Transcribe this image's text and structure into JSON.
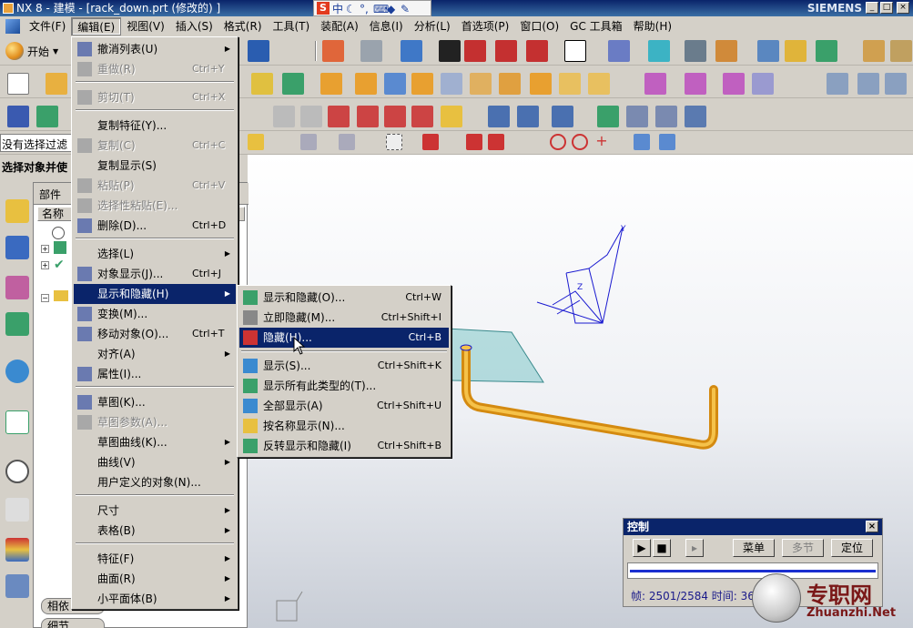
{
  "window": {
    "title": "NX 8 - 建模 - [rack_down.prt (修改的) ]",
    "brand": "SIEMENS"
  },
  "ime": {
    "logo": "S",
    "mode": "中"
  },
  "menubar": {
    "items": [
      "文件(F)",
      "编辑(E)",
      "视图(V)",
      "插入(S)",
      "格式(R)",
      "工具(T)",
      "装配(A)",
      "信息(I)",
      "分析(L)",
      "首选项(P)",
      "窗口(O)",
      "GC 工具箱",
      "帮助(H)"
    ]
  },
  "toolbar": {
    "start_label": "开始"
  },
  "filter": {
    "label": "没有选择过滤"
  },
  "select_row": {
    "label": "选择对象并使"
  },
  "navigator": {
    "title": "部件",
    "col_name": "名称",
    "buttons": [
      "相依",
      "细节"
    ]
  },
  "edit_menu": {
    "items": [
      {
        "label": "撤消列表(U)",
        "shortcut": "",
        "submenu": true,
        "disabled": false,
        "icon": "undo-list-icon"
      },
      {
        "label": "重做(R)",
        "shortcut": "Ctrl+Y",
        "submenu": false,
        "disabled": true,
        "icon": "redo-icon"
      },
      {
        "label": "剪切(T)",
        "shortcut": "Ctrl+X",
        "submenu": false,
        "disabled": true,
        "icon": "cut-icon"
      },
      {
        "label": "复制特征(Y)...",
        "shortcut": "",
        "submenu": false,
        "disabled": false,
        "icon": ""
      },
      {
        "label": "复制(C)",
        "shortcut": "Ctrl+C",
        "submenu": false,
        "disabled": true,
        "icon": "copy-icon"
      },
      {
        "label": "复制显示(S)",
        "shortcut": "",
        "submenu": false,
        "disabled": false,
        "icon": ""
      },
      {
        "label": "粘贴(P)",
        "shortcut": "Ctrl+V",
        "submenu": false,
        "disabled": true,
        "icon": "paste-icon"
      },
      {
        "label": "选择性粘贴(E)...",
        "shortcut": "",
        "submenu": false,
        "disabled": true,
        "icon": "paste-special-icon"
      },
      {
        "label": "删除(D)...",
        "shortcut": "Ctrl+D",
        "submenu": false,
        "disabled": false,
        "icon": "delete-icon"
      },
      {
        "label": "选择(L)",
        "shortcut": "",
        "submenu": true,
        "disabled": false,
        "icon": ""
      },
      {
        "label": "对象显示(J)...",
        "shortcut": "Ctrl+J",
        "submenu": false,
        "disabled": false,
        "icon": "object-display-icon"
      },
      {
        "label": "显示和隐藏(H)",
        "shortcut": "",
        "submenu": true,
        "disabled": false,
        "icon": "",
        "highlighted": true
      },
      {
        "label": "变换(M)...",
        "shortcut": "",
        "submenu": false,
        "disabled": false,
        "icon": "transform-icon"
      },
      {
        "label": "移动对象(O)...",
        "shortcut": "Ctrl+T",
        "submenu": false,
        "disabled": false,
        "icon": "move-object-icon"
      },
      {
        "label": "对齐(A)",
        "shortcut": "",
        "submenu": true,
        "disabled": false,
        "icon": ""
      },
      {
        "label": "属性(I)...",
        "shortcut": "",
        "submenu": false,
        "disabled": false,
        "icon": "properties-icon"
      },
      {
        "label": "草图(K)...",
        "shortcut": "",
        "submenu": false,
        "disabled": false,
        "icon": "sketch-icon"
      },
      {
        "label": "草图参数(A)...",
        "shortcut": "",
        "submenu": false,
        "disabled": true,
        "icon": "sketch-params-icon"
      },
      {
        "label": "草图曲线(K)...",
        "shortcut": "",
        "submenu": true,
        "disabled": false,
        "icon": ""
      },
      {
        "label": "曲线(V)",
        "shortcut": "",
        "submenu": true,
        "disabled": false,
        "icon": ""
      },
      {
        "label": "用户定义的对象(N)...",
        "shortcut": "",
        "submenu": false,
        "disabled": false,
        "icon": ""
      },
      {
        "label": "尺寸",
        "shortcut": "",
        "submenu": true,
        "disabled": false,
        "icon": ""
      },
      {
        "label": "表格(B)",
        "shortcut": "",
        "submenu": true,
        "disabled": false,
        "icon": ""
      },
      {
        "label": "特征(F)",
        "shortcut": "",
        "submenu": true,
        "disabled": false,
        "icon": ""
      },
      {
        "label": "曲面(R)",
        "shortcut": "",
        "submenu": true,
        "disabled": false,
        "icon": ""
      },
      {
        "label": "小平面体(B)",
        "shortcut": "",
        "submenu": true,
        "disabled": false,
        "icon": ""
      }
    ]
  },
  "show_hide_menu": {
    "items": [
      {
        "label": "显示和隐藏(O)...",
        "shortcut": "Ctrl+W",
        "icon": "show-hide-icon"
      },
      {
        "label": "立即隐藏(M)...",
        "shortcut": "Ctrl+Shift+I",
        "icon": "immediate-hide-icon"
      },
      {
        "label": "隐藏(H)...",
        "shortcut": "Ctrl+B",
        "icon": "hide-icon",
        "highlighted": true
      },
      {
        "label": "显示(S)...",
        "shortcut": "Ctrl+Shift+K",
        "icon": "show-icon"
      },
      {
        "label": "显示所有此类型的(T)...",
        "shortcut": "",
        "icon": "show-all-type-icon"
      },
      {
        "label": "全部显示(A)",
        "shortcut": "Ctrl+Shift+U",
        "icon": "show-all-icon"
      },
      {
        "label": "按名称显示(N)...",
        "shortcut": "",
        "icon": "show-by-name-icon"
      },
      {
        "label": "反转显示和隐藏(I)",
        "shortcut": "Ctrl+Shift+B",
        "icon": "invert-show-hide-icon"
      }
    ]
  },
  "control_panel": {
    "title": "控制",
    "menu_button": "菜单",
    "multi_step_button": "多节",
    "locate_button": "定位",
    "frame_label": "帧: 2501/2584 时间:",
    "time_value": "36"
  },
  "watermark": {
    "text": "专职网",
    "url": "Zhuanzhi.Net"
  },
  "colors": {
    "menu_highlight": "#0a246a",
    "part": "#e8a317",
    "plane": "#7fc7c8",
    "csys": "#1a1ad0"
  }
}
